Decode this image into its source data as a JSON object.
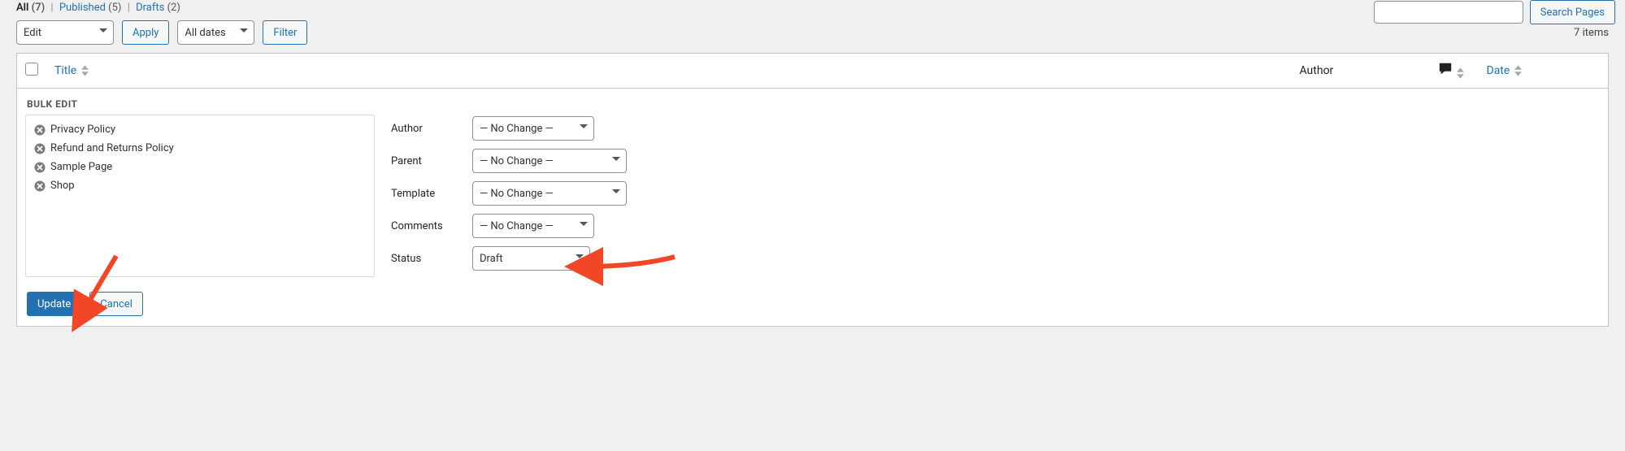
{
  "filters": {
    "all_label": "All",
    "all_count": "(7)",
    "published_label": "Published",
    "published_count": "(5)",
    "drafts_label": "Drafts",
    "drafts_count": "(2)"
  },
  "search": {
    "button": "Search Pages",
    "value": ""
  },
  "bulk_action": {
    "selected": "Edit",
    "apply": "Apply"
  },
  "date_filter": {
    "selected": "All dates",
    "filter": "Filter"
  },
  "result_count": "7 items",
  "columns": {
    "title": "Title",
    "author": "Author",
    "comments": "",
    "date": "Date"
  },
  "bulk_edit": {
    "heading": "BULK EDIT",
    "items": [
      "Privacy Policy",
      "Refund and Returns Policy",
      "Sample Page",
      "Shop"
    ],
    "fields": {
      "author": {
        "label": "Author",
        "value": "— No Change —"
      },
      "parent": {
        "label": "Parent",
        "value": "— No Change —"
      },
      "template": {
        "label": "Template",
        "value": "— No Change —"
      },
      "comments": {
        "label": "Comments",
        "value": "— No Change —"
      },
      "status": {
        "label": "Status",
        "value": "Draft"
      }
    },
    "update": "Update",
    "cancel": "Cancel"
  }
}
